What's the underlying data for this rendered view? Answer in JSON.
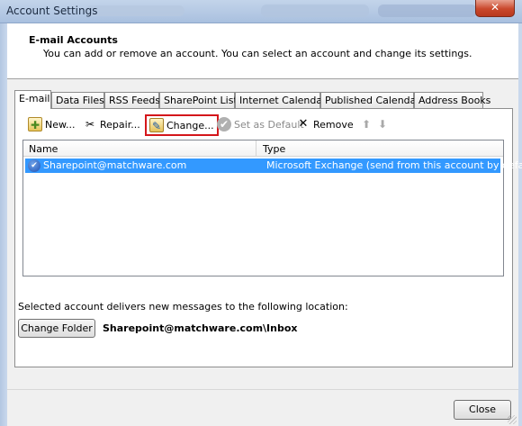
{
  "window": {
    "title": "Account Settings",
    "close_glyph": "✕"
  },
  "header": {
    "title": "E-mail Accounts",
    "description": "You can add or remove an account. You can select an account and change its settings."
  },
  "tabs": [
    {
      "label": "E-mail",
      "active": true
    },
    {
      "label": "Data Files"
    },
    {
      "label": "RSS Feeds"
    },
    {
      "label": "SharePoint Lists"
    },
    {
      "label": "Internet Calendars"
    },
    {
      "label": "Published Calendars"
    },
    {
      "label": "Address Books"
    }
  ],
  "toolbar": {
    "new_label": "New...",
    "repair_label": "Repair...",
    "change_label": "Change...",
    "set_default_label": "Set as Default",
    "remove_label": "Remove",
    "highlight_color": "#d4161b"
  },
  "accounts_list": {
    "columns": [
      "Name",
      "Type"
    ],
    "rows": [
      {
        "name": "Sharepoint@matchware.com",
        "type": "Microsoft Exchange (send from this account by default)",
        "selected": true
      }
    ],
    "selection_color": "#3399ff"
  },
  "delivery": {
    "text": "Selected account delivers new messages to the following location:",
    "change_folder_label": "Change Folder",
    "location": "Sharepoint@matchware.com\\Inbox"
  },
  "footer": {
    "close_label": "Close"
  }
}
